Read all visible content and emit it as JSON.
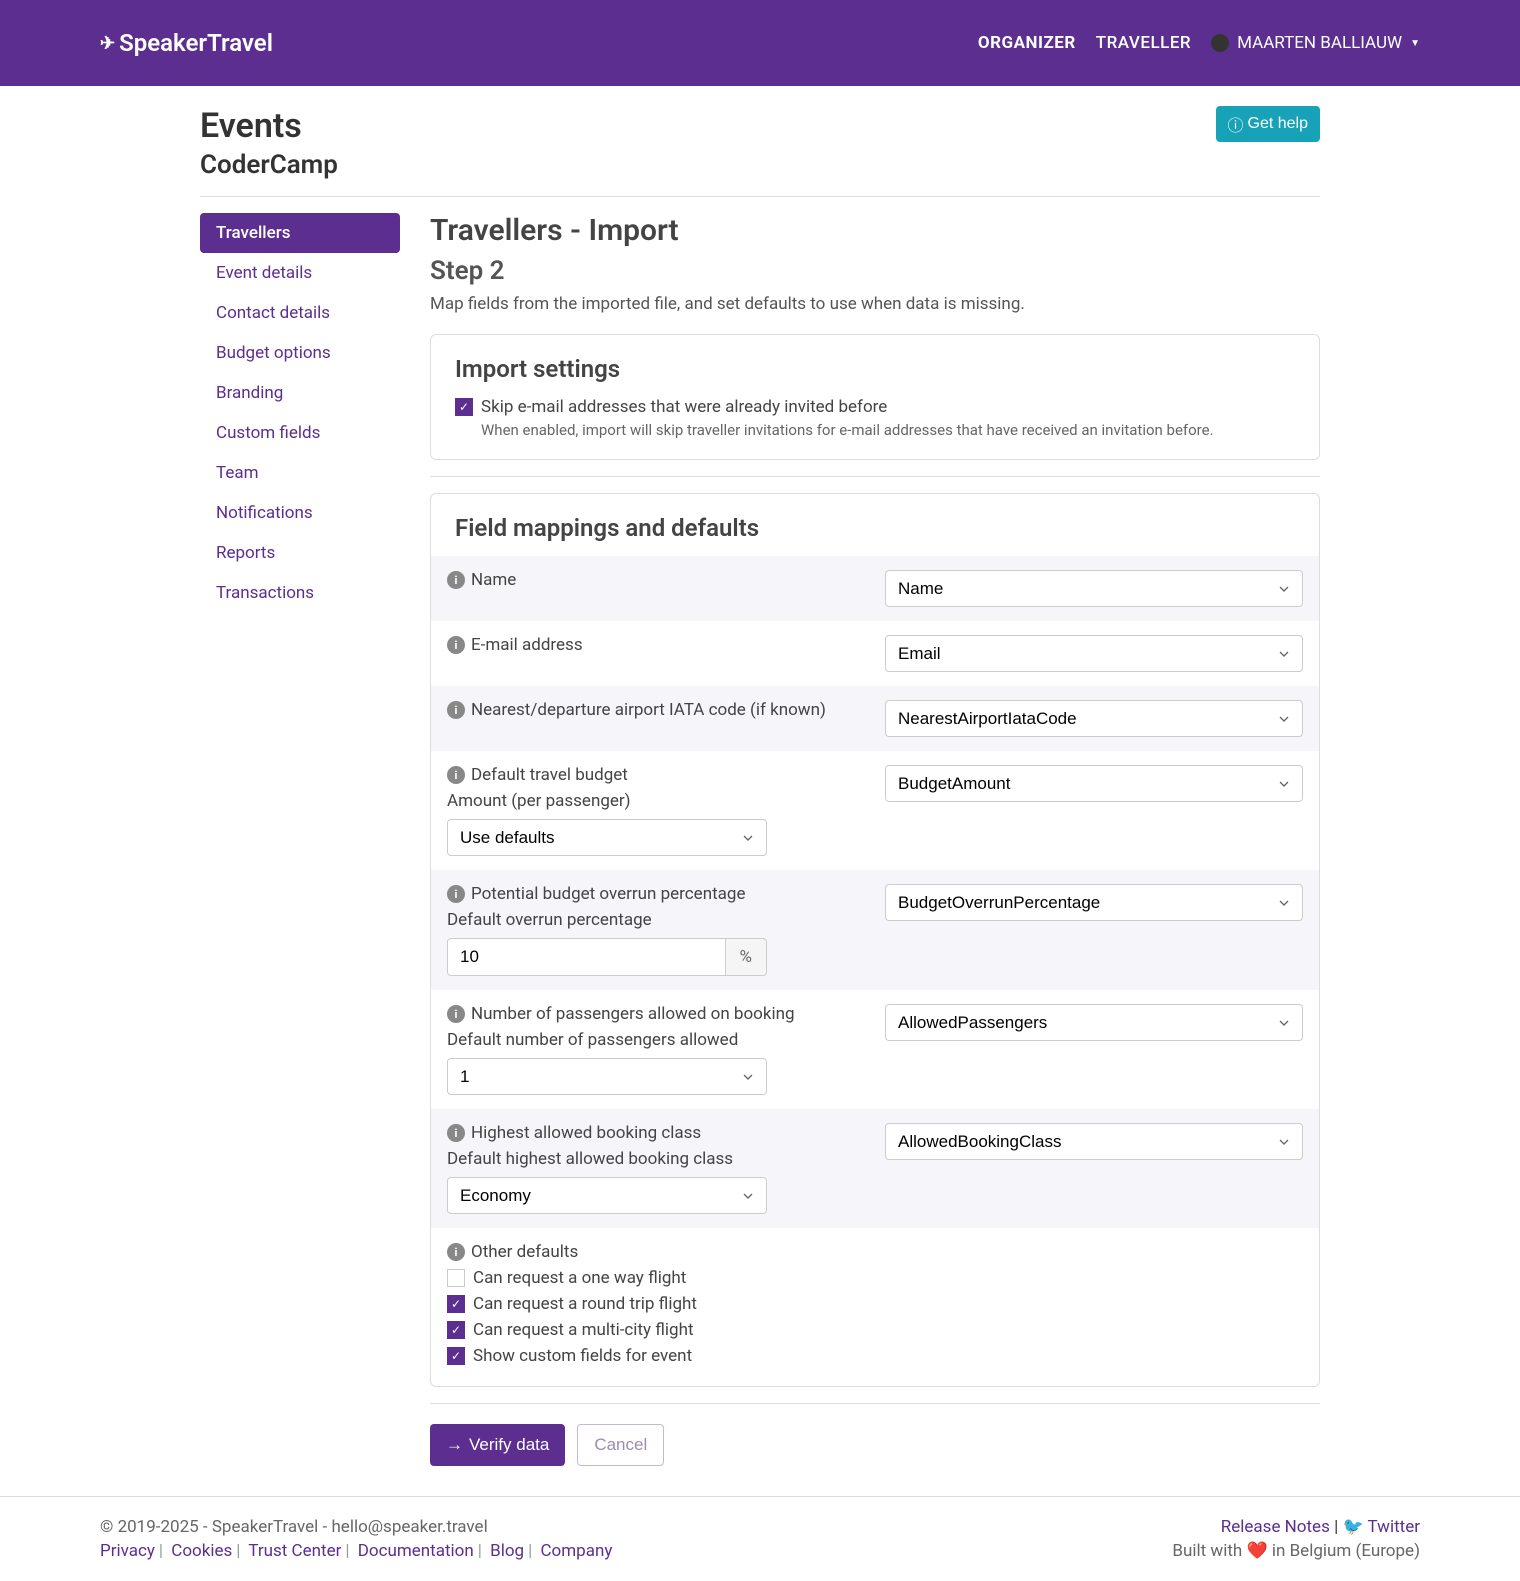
{
  "brand": "SpeakerTravel",
  "nav": {
    "organizer": "ORGANIZER",
    "traveller": "TRAVELLER",
    "user": "MAARTEN BALLIAUW"
  },
  "page": {
    "title": "Events",
    "subtitle": "CoderCamp",
    "help": "Get help"
  },
  "sidebar": {
    "items": [
      {
        "label": "Travellers"
      },
      {
        "label": "Event details"
      },
      {
        "label": "Contact details"
      },
      {
        "label": "Budget options"
      },
      {
        "label": "Branding"
      },
      {
        "label": "Custom fields"
      },
      {
        "label": "Team"
      },
      {
        "label": "Notifications"
      },
      {
        "label": "Reports"
      },
      {
        "label": "Transactions"
      }
    ]
  },
  "content": {
    "title": "Travellers - Import",
    "step": "Step 2",
    "desc": "Map fields from the imported file, and set defaults to use when data is missing."
  },
  "import_settings": {
    "title": "Import settings",
    "skip_label": "Skip e-mail addresses that were already invited before",
    "skip_help": "When enabled, import will skip traveller invitations for e-mail addresses that have received an invitation before."
  },
  "mappings": {
    "title": "Field mappings and defaults",
    "name": {
      "label": "Name",
      "value": "Name"
    },
    "email": {
      "label": "E-mail address",
      "value": "Email"
    },
    "airport": {
      "label": "Nearest/departure airport IATA code (if known)",
      "value": "NearestAirportIataCode"
    },
    "budget": {
      "label": "Default travel budget",
      "value": "BudgetAmount",
      "sublabel": "Amount (per passenger)",
      "default": "Use defaults"
    },
    "overrun": {
      "label": "Potential budget overrun percentage",
      "value": "BudgetOverrunPercentage",
      "sublabel": "Default overrun percentage",
      "default": "10",
      "unit": "%"
    },
    "passengers": {
      "label": "Number of passengers allowed on booking",
      "value": "AllowedPassengers",
      "sublabel": "Default number of passengers allowed",
      "default": "1"
    },
    "class": {
      "label": "Highest allowed booking class",
      "value": "AllowedBookingClass",
      "sublabel": "Default highest allowed booking class",
      "default": "Economy"
    },
    "other": {
      "label": "Other defaults",
      "oneway": "Can request a one way flight",
      "round": "Can request a round trip flight",
      "multi": "Can request a multi-city flight",
      "custom": "Show custom fields for event"
    }
  },
  "actions": {
    "verify": "Verify data",
    "cancel": "Cancel"
  },
  "footer": {
    "copyright": "© 2019-2025 - SpeakerTravel - hello@speaker.travel",
    "links": {
      "privacy": "Privacy",
      "cookies": "Cookies",
      "trust": "Trust Center",
      "docs": "Documentation",
      "blog": "Blog",
      "company": "Company"
    },
    "release": "Release Notes",
    "twitter": "Twitter",
    "built": "Built with ❤️ in Belgium (Europe)"
  }
}
